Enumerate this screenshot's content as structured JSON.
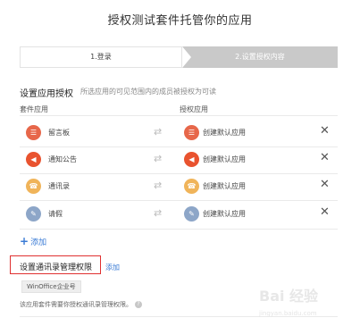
{
  "header": {
    "title": "授权测试套件托管你的应用"
  },
  "steps": [
    {
      "label": "1.登录"
    },
    {
      "label": "2.设置授权内容"
    }
  ],
  "section": {
    "title": "设置应用授权",
    "subtitle": "所选应用的可见范围内的成员被授权为可读",
    "col_left": "套件应用",
    "col_right": "授权应用"
  },
  "rows": [
    {
      "left_label": "留言板",
      "left_color": "#e7674a",
      "left_icon": "☰",
      "right_label": "创建默认应用",
      "right_color": "#e7674a",
      "right_icon": "☰"
    },
    {
      "left_label": "通知公告",
      "left_color": "#e9532f",
      "left_icon": "◀",
      "right_label": "创建默认应用",
      "right_color": "#e9532f",
      "right_icon": "◀"
    },
    {
      "left_label": "通讯录",
      "left_color": "#f0b45a",
      "left_icon": "☎",
      "right_label": "创建默认应用",
      "right_color": "#f0b45a",
      "right_icon": "☎"
    },
    {
      "left_label": "请假",
      "left_color": "#8da6c8",
      "left_icon": "✎",
      "right_label": "创建默认应用",
      "right_color": "#8da6c8",
      "right_icon": "✎"
    }
  ],
  "add_link": "添加",
  "permissions": {
    "title": "设置通讯录管理权限",
    "add_label": "添加",
    "tag": "WinOffice企业号",
    "note": "该应用套件需要你授权通讯录管理权限。",
    "help_glyph": "?"
  },
  "watermark": {
    "brand": "Bai 经验",
    "url": "jingyan.baidu.com"
  }
}
